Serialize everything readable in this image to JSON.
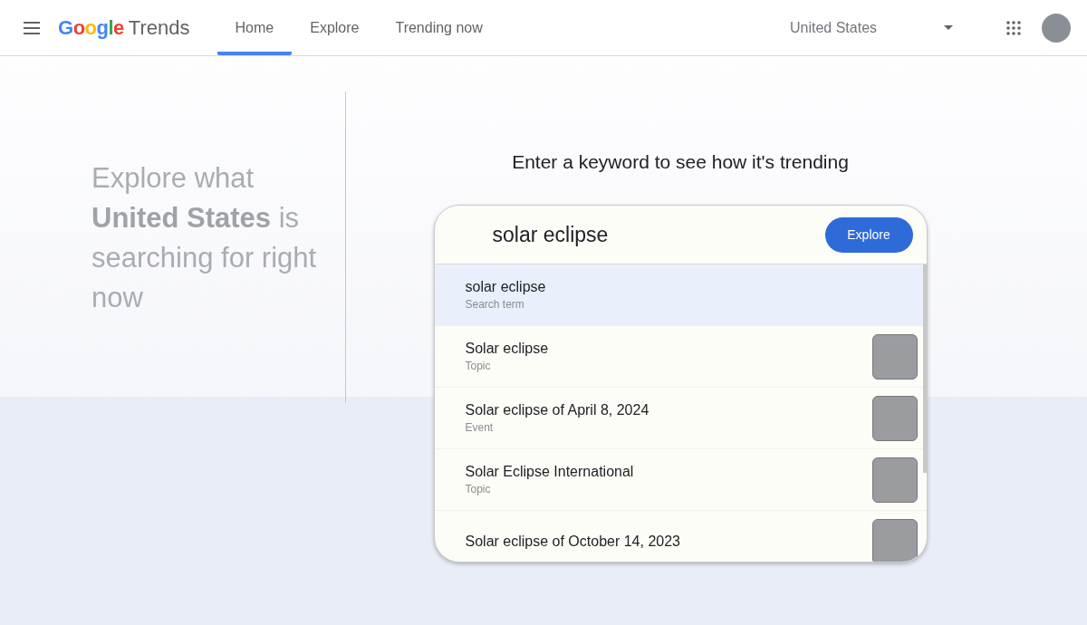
{
  "header": {
    "logo_brand": "Google",
    "logo_product": "Trends",
    "nav": [
      {
        "label": "Home",
        "selected": true
      },
      {
        "label": "Explore",
        "selected": false
      },
      {
        "label": "Trending now",
        "selected": false
      }
    ],
    "region": "United States"
  },
  "hero": {
    "text": "Explore what **United States** is searching for right now"
  },
  "search": {
    "prompt": "Enter a keyword to see how it's trending",
    "value": "solar eclipse",
    "button": "Explore",
    "suggestions": [
      {
        "title": "solar eclipse",
        "type": "Search term",
        "selected": true,
        "thumbnail": false
      },
      {
        "title": "Solar eclipse",
        "type": "Topic",
        "selected": false,
        "thumbnail": true
      },
      {
        "title": "Solar eclipse of April 8, 2024",
        "type": "Event",
        "selected": false,
        "thumbnail": true
      },
      {
        "title": "Solar Eclipse International",
        "type": "Topic",
        "selected": false,
        "thumbnail": true
      },
      {
        "title": "Solar eclipse of October 14, 2023",
        "selected": false,
        "thumbnail": true
      }
    ]
  }
}
